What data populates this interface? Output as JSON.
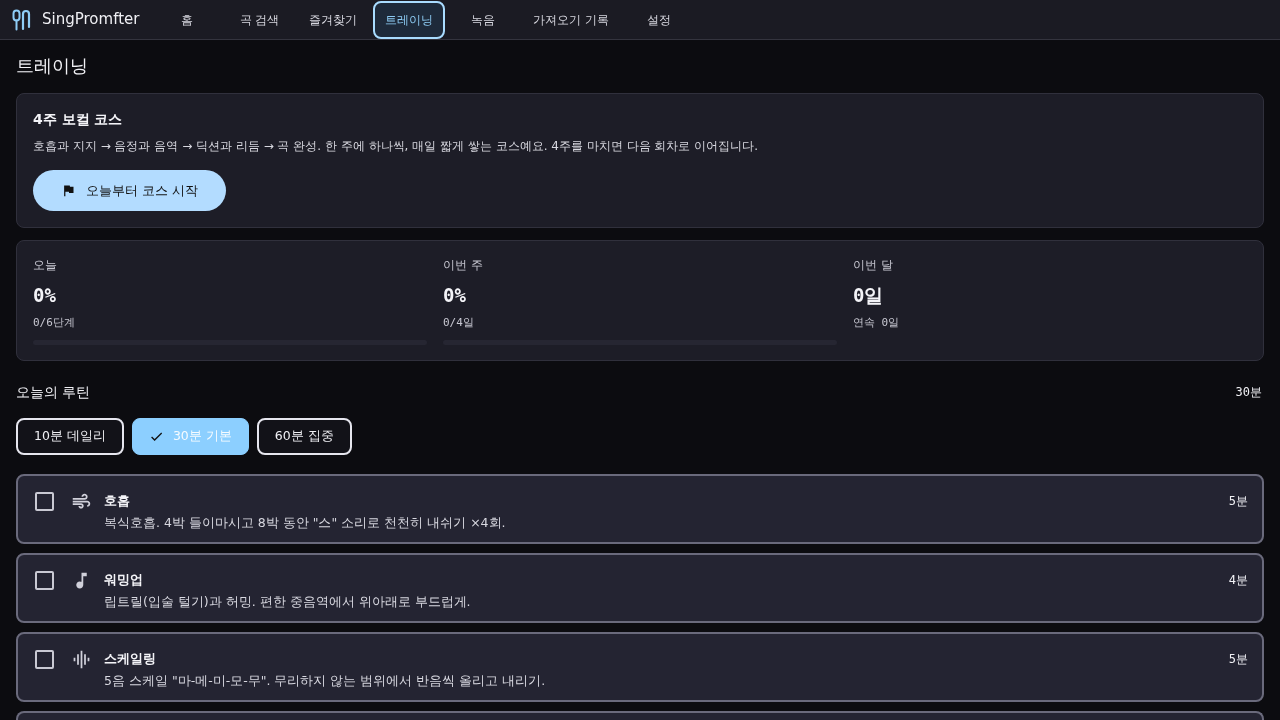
{
  "app": {
    "name": "SingPromfter"
  },
  "nav": [
    {
      "label": "홈",
      "selected": false
    },
    {
      "label": "곡 검색",
      "selected": false
    },
    {
      "label": "즐겨찾기",
      "selected": false
    },
    {
      "label": "트레이닝",
      "selected": true
    },
    {
      "label": "녹음",
      "selected": false
    },
    {
      "label": "가져오기 기록",
      "selected": false
    },
    {
      "label": "설정",
      "selected": false
    }
  ],
  "page_title": "트레이닝",
  "course": {
    "title": "4주 보컬 코스",
    "description": "호흡과 지지 → 음정과 음역 → 딕션과 리듬 → 곡 완성. 한 주에 하나씩, 매일 짧게 쌓는 코스예요. 4주를 마치면 다음 회차로 이어집니다.",
    "button": "오늘부터 코스 시작"
  },
  "stats": [
    {
      "kind": "progress",
      "label": "오늘",
      "value": "0%",
      "detail": "0/6단계"
    },
    {
      "kind": "progress",
      "label": "이번 주",
      "value": "0%",
      "detail": "0/4일"
    },
    {
      "kind": "count",
      "label": "이번 달",
      "value": "0일",
      "detail": "연속 0일"
    }
  ],
  "routine": {
    "title": "오늘의 루틴",
    "total": "30분",
    "presets": [
      {
        "label": "10분 데일리",
        "selected": false
      },
      {
        "label": "30분 기본",
        "selected": true
      },
      {
        "label": "60분 집중",
        "selected": false
      }
    ],
    "tasks": [
      {
        "kind": "breath",
        "title": "호흡",
        "description": "복식호흡. 4박 들이마시고 8박 동안 \"스\" 소리로 천천히 내쉬기 ×4회.",
        "duration": "5분",
        "checked": false
      },
      {
        "kind": "warmup",
        "title": "워밍업",
        "description": "립트릴(입술 털기)과 허밍. 편한 중음역에서 위아래로 부드럽게.",
        "duration": "4분",
        "checked": false
      },
      {
        "kind": "scale",
        "title": "스케일링",
        "description": "5음 스케일 \"마-메-미-모-무\". 무리하지 않는 범위에서 반음씩 올리고 내리기.",
        "duration": "5분",
        "checked": false
      }
    ]
  }
}
